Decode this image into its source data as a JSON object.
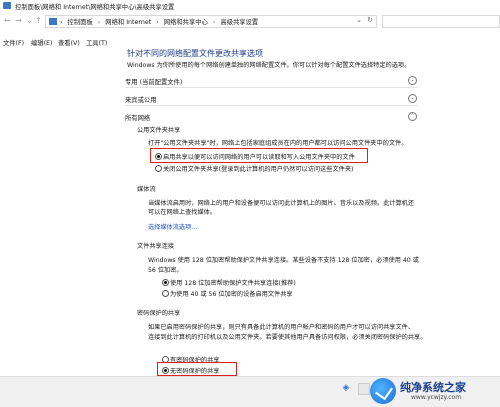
{
  "window": {
    "title": "控制面板\\网络和 Internet\\网络和共享中心\\高级共享设置"
  },
  "address_bar": {
    "breadcrumbs": [
      "控制面板",
      "网络和 Internet",
      "网络和共享中心",
      "高级共享设置"
    ],
    "separator": "›",
    "search_placeholder": ""
  },
  "menu": {
    "items": [
      "文件(F)",
      "编辑(E)",
      "查看(V)",
      "工具(T)"
    ]
  },
  "content": {
    "heading": "针对不同的网络配置文件更改共享选项",
    "description": "Windows 为你所使用的每个网络创建单独的网络配置文件。你可以针对每个配置文件选择特定的选项。",
    "profiles": [
      {
        "label": "专用 (当前配置文件)"
      },
      {
        "label": "来宾或公用"
      },
      {
        "label": "所有网络"
      }
    ],
    "public_folder_sharing": {
      "title": "公用文件夹共享",
      "description": "打开\"公用文件夹共享\"时，网络上包括家庭组成员在内的用户都可以访问公用文件夹中的文件。",
      "options": [
        {
          "label": "启用共享以便可以访问网络的用户可以读取和写入公用文件夹中的文件",
          "selected": true
        },
        {
          "label": "关闭公用文件夹共享(登录到此计算机的用户仍然可以访问这些文件夹)",
          "selected": false
        }
      ]
    },
    "media_streaming": {
      "title": "媒体流",
      "description_lines": [
        "当媒体流启用时，网络上的用户和设备便可以访问此计算机上的图片、音乐以及视频。此计算机还",
        "可以在网络上查找媒体。"
      ],
      "link": "选择媒体流选项..."
    },
    "file_sharing_connections": {
      "title": "文件共享连接",
      "description_lines": [
        "Windows 使用 128 位加密帮助保护文件共享连接。某些设备不支持 128 位加密，必须使用 40 或",
        "56 位加密。"
      ],
      "options": [
        {
          "label": "使用 128 位加密帮助保护文件共享连接(推荐)",
          "selected": true
        },
        {
          "label": "为使用 40 或 56 位加密的设备启用文件共享",
          "selected": false
        }
      ]
    },
    "password_protected_sharing": {
      "title": "密码保护的共享",
      "description_lines": [
        "如果已启用密码保护的共享，则只有具备此计算机的用户帐户和密码的用户才可以访问共享文件、",
        "连接到此计算机的打印机以及公用文件夹。若要使其他用户具备访问权限，必须关闭密码保护的共享。"
      ],
      "options": [
        {
          "label": "有密码保护的共享",
          "selected": false
        },
        {
          "label": "无密码保护的共享",
          "selected": true
        }
      ]
    }
  },
  "watermark": {
    "title": "纯净系统之家",
    "url": "www.ycwjzy.com"
  },
  "colors": {
    "highlight_box": "#e02020",
    "link": "#1a55c0",
    "heading": "#1e3a8a"
  }
}
